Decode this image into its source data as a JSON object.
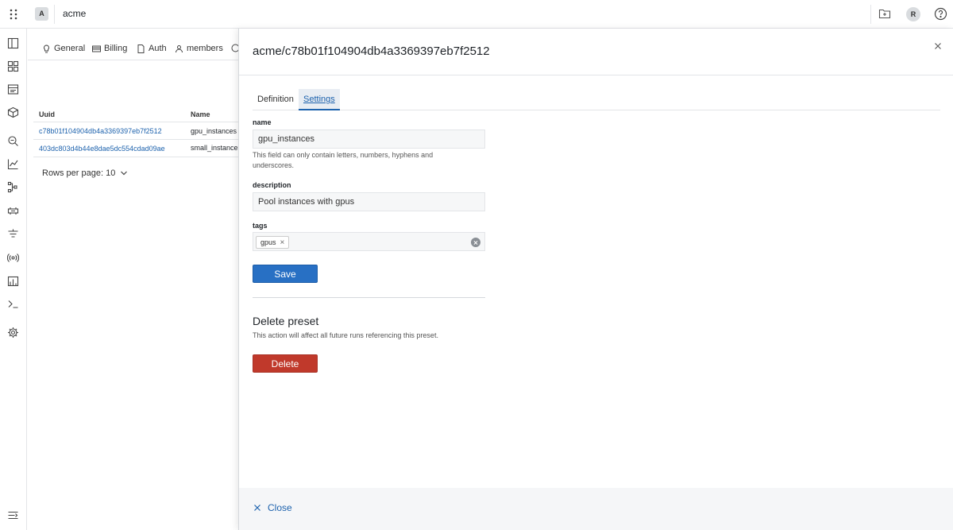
{
  "topbar": {
    "org_initial": "A",
    "org_name": "acme",
    "user_initial": "R"
  },
  "rail": {
    "icons": [
      "panel-icon",
      "dashboard-icon",
      "runs-icon",
      "components-icon",
      "search-icon",
      "analytics-icon",
      "dag-icon",
      "agents-icon",
      "filter-icon",
      "connections-icon",
      "chart-icon",
      "terminal-icon",
      "settings-icon",
      "expand-icon"
    ]
  },
  "background": {
    "tabs": [
      {
        "label": "General",
        "icon": "bulb-icon"
      },
      {
        "label": "Billing",
        "icon": "card-icon"
      },
      {
        "label": "Auth",
        "icon": "doc-icon"
      },
      {
        "label": "members",
        "icon": "user-icon"
      }
    ],
    "table": {
      "columns": [
        "Uuid",
        "Name"
      ],
      "rows": [
        {
          "uuid": "c78b01f104904db4a3369397eb7f2512",
          "name": "gpu_instances"
        },
        {
          "uuid": "403dc803d4b44e8dae5dc554cdad09ae",
          "name": "small_instance"
        }
      ]
    },
    "rows_per_page_label": "Rows per page: 10"
  },
  "drawer": {
    "title": "acme/c78b01f104904db4a3369397eb7f2512",
    "tabs": [
      "Definition",
      "Settings"
    ],
    "active_tab": "Settings",
    "form": {
      "name_label": "name",
      "name_value": "gpu_instances",
      "name_help": "This field can only contain letters, numbers, hyphens and underscores.",
      "description_label": "description",
      "description_value": "Pool instances with gpus",
      "tags_label": "tags",
      "tags": [
        "gpus"
      ],
      "chip_remove": "×",
      "save_label": "Save"
    },
    "delete_section": {
      "title": "Delete preset",
      "description": "This action will affect all future runs referencing this preset.",
      "button_label": "Delete"
    },
    "footer": {
      "close_label": "Close"
    }
  },
  "colors": {
    "primary": "#2870c4",
    "danger": "#c0392b",
    "link": "#1d62ad"
  }
}
